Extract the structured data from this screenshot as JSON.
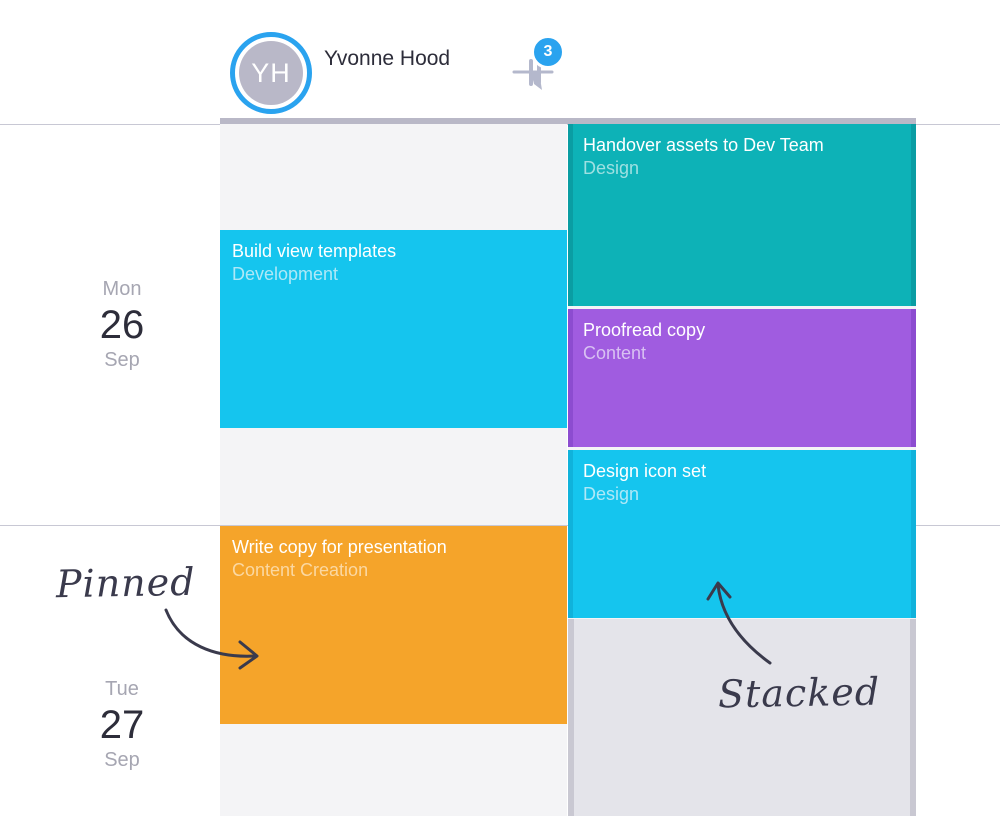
{
  "header": {
    "user": {
      "initials": "YH",
      "name": "Yvonne Hood"
    },
    "pinned_count": "3",
    "accent_color": "#2aa3ef"
  },
  "days": [
    {
      "weekday": "Mon",
      "day": "26",
      "month": "Sep"
    },
    {
      "weekday": "Tue",
      "day": "27",
      "month": "Sep"
    }
  ],
  "tasks": {
    "build_view_templates": {
      "title": "Build view templates",
      "category": "Development",
      "color": "#15c5ee"
    },
    "write_copy": {
      "title": "Write copy for presentation",
      "category": "Content Creation",
      "color": "#f5a42a"
    },
    "handover_assets": {
      "title": "Handover assets to Dev Team",
      "category": "Design",
      "color": "#0db2b7"
    },
    "proofread_copy": {
      "title": "Proofread copy",
      "category": "Content",
      "color": "#a05ce0"
    },
    "design_icon_set": {
      "title": "Design icon set",
      "category": "Design",
      "color": "#15c5ee"
    }
  },
  "annotations": {
    "pinned": "Pinned",
    "stacked": "Stacked"
  },
  "icons": {
    "pin": "pin-icon",
    "avatar": "avatar"
  }
}
